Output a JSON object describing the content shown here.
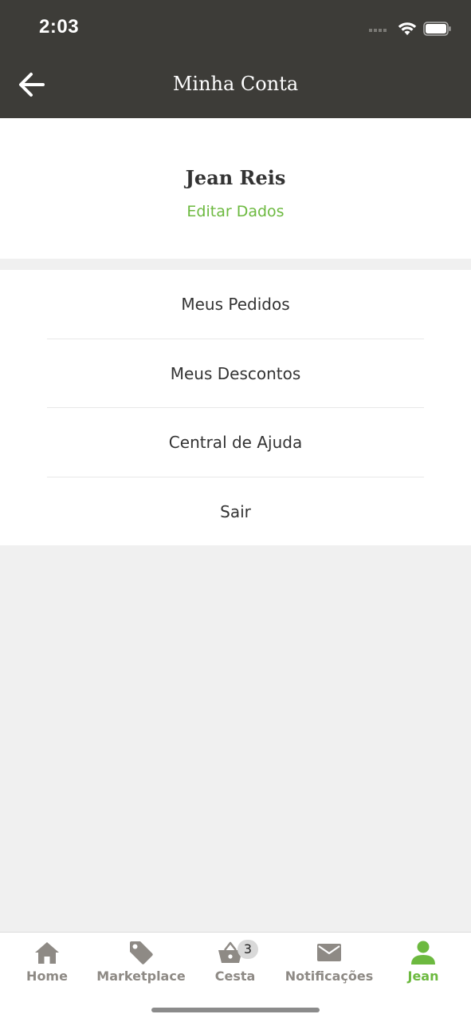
{
  "status_bar": {
    "time": "2:03"
  },
  "header": {
    "title": "Minha Conta",
    "background": "#3d3c38"
  },
  "profile": {
    "name": "Jean Reis",
    "edit_label": "Editar Dados"
  },
  "menu": {
    "items": [
      {
        "label": "Meus Pedidos"
      },
      {
        "label": "Meus Descontos"
      },
      {
        "label": "Central de Ajuda"
      },
      {
        "label": "Sair"
      }
    ]
  },
  "tabbar": {
    "tabs": [
      {
        "label": "Home",
        "icon": "home-icon"
      },
      {
        "label": "Marketplace",
        "icon": "tag-icon"
      },
      {
        "label": "Cesta",
        "icon": "basket-icon",
        "badge": "3"
      },
      {
        "label": "Notificações",
        "icon": "mail-icon"
      },
      {
        "label": "Jean",
        "icon": "user-icon",
        "active": true
      }
    ]
  },
  "colors": {
    "accent": "#6cb93f",
    "inactive": "#8e8a85",
    "background": "#f0f0f0"
  }
}
